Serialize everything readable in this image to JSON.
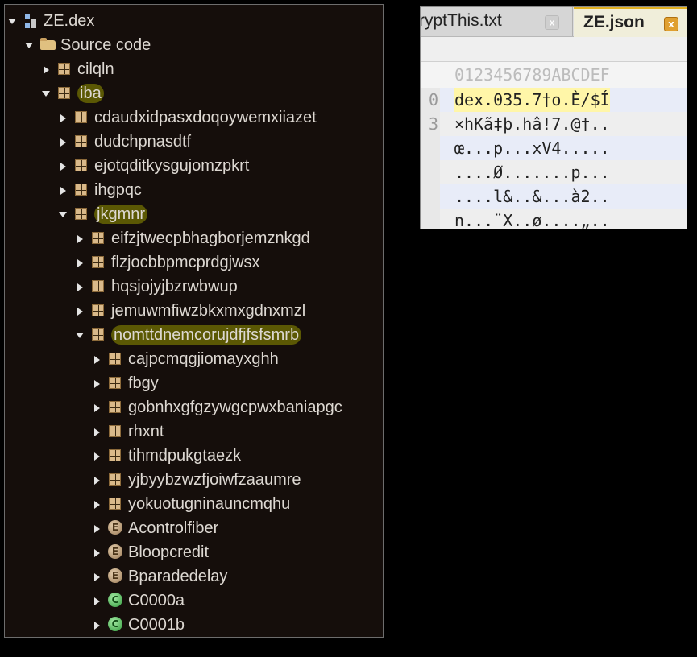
{
  "tree": {
    "rows": [
      {
        "depth": 0,
        "arrow": "expanded",
        "icon": "dex-icon",
        "label": "ZE.dex",
        "hl": false
      },
      {
        "depth": 1,
        "arrow": "expanded",
        "icon": "folder-icon",
        "label": "Source code",
        "hl": false
      },
      {
        "depth": 2,
        "arrow": "collapsed",
        "icon": "package-icon",
        "label": "cilqln",
        "hl": false
      },
      {
        "depth": 2,
        "arrow": "expanded",
        "icon": "package-icon",
        "label": "iba",
        "hl": true
      },
      {
        "depth": 3,
        "arrow": "collapsed",
        "icon": "package-icon",
        "label": "cdaudxidpasxdoqoywemxiiazet",
        "hl": false
      },
      {
        "depth": 3,
        "arrow": "collapsed",
        "icon": "package-icon",
        "label": "dudchpnasdtf",
        "hl": false
      },
      {
        "depth": 3,
        "arrow": "collapsed",
        "icon": "package-icon",
        "label": "ejotqditkysgujomzpkrt",
        "hl": false
      },
      {
        "depth": 3,
        "arrow": "collapsed",
        "icon": "package-icon",
        "label": "ihgpqc",
        "hl": false
      },
      {
        "depth": 3,
        "arrow": "expanded",
        "icon": "package-icon",
        "label": "jkgmnr",
        "hl": true
      },
      {
        "depth": 4,
        "arrow": "collapsed",
        "icon": "package-icon",
        "label": "eifzjtwecpbhagborjemznkgd",
        "hl": false
      },
      {
        "depth": 4,
        "arrow": "collapsed",
        "icon": "package-icon",
        "label": "flzjocbbpmcprdgjwsx",
        "hl": false
      },
      {
        "depth": 4,
        "arrow": "collapsed",
        "icon": "package-icon",
        "label": "hqsjojyjbzrwbwup",
        "hl": false
      },
      {
        "depth": 4,
        "arrow": "collapsed",
        "icon": "package-icon",
        "label": "jemuwmfiwzbkxmxgdnxmzl",
        "hl": false
      },
      {
        "depth": 4,
        "arrow": "expanded",
        "icon": "package-icon",
        "label": "nomttdnemcorujdfjfsfsmrb",
        "hl": true
      },
      {
        "depth": 5,
        "arrow": "collapsed",
        "icon": "package-icon",
        "label": "cajpcmqgjiomayxghh",
        "hl": false
      },
      {
        "depth": 5,
        "arrow": "collapsed",
        "icon": "package-icon",
        "label": "fbgy",
        "hl": false
      },
      {
        "depth": 5,
        "arrow": "collapsed",
        "icon": "package-icon",
        "label": "gobnhxgfgzywgcpwxbaniapgc",
        "hl": false
      },
      {
        "depth": 5,
        "arrow": "collapsed",
        "icon": "package-icon",
        "label": "rhxnt",
        "hl": false
      },
      {
        "depth": 5,
        "arrow": "collapsed",
        "icon": "package-icon",
        "label": "tihmdpukgtaezk",
        "hl": false
      },
      {
        "depth": 5,
        "arrow": "collapsed",
        "icon": "package-icon",
        "label": "yjbyybzwzfjoiwfzaaumre",
        "hl": false
      },
      {
        "depth": 5,
        "arrow": "collapsed",
        "icon": "package-icon",
        "label": "yokuotugninauncmqhu",
        "hl": false
      },
      {
        "depth": 5,
        "arrow": "collapsed",
        "icon": "enum-icon",
        "label": "Acontrolfiber",
        "hl": false
      },
      {
        "depth": 5,
        "arrow": "collapsed",
        "icon": "enum-icon",
        "label": "Bloopcredit",
        "hl": false
      },
      {
        "depth": 5,
        "arrow": "collapsed",
        "icon": "enum-icon",
        "label": "Bparadedelay",
        "hl": false
      },
      {
        "depth": 5,
        "arrow": "collapsed",
        "icon": "class-icon",
        "label": "C0000a",
        "hl": false
      },
      {
        "depth": 5,
        "arrow": "collapsed",
        "icon": "class-icon",
        "label": "C0001b",
        "hl": false
      }
    ]
  },
  "hex": {
    "tabs": [
      {
        "label": "ryptThis.txt",
        "close": "x",
        "active": false
      },
      {
        "label": "ZE.json",
        "close": "x",
        "active": true
      }
    ],
    "header": "0123456789ABCDEF",
    "rows": [
      {
        "offset": "0",
        "text": "dex.035.7†o.È/$Í",
        "selected": true
      },
      {
        "offset": "3",
        "text": "×hKã‡þ.hâ!7.@†..",
        "selected": false
      },
      {
        "offset": "",
        "text": "œ...p...xV4.....",
        "selected": false
      },
      {
        "offset": "",
        "text": "....Ø.......p...",
        "selected": false
      },
      {
        "offset": "",
        "text": "....l&..&...à2..",
        "selected": false
      },
      {
        "offset": "",
        "text": "n...¨X..ø....„..",
        "selected": false
      }
    ]
  },
  "colors": {
    "tree_bg": "#150e0b",
    "tree_text": "#ddd8d2",
    "highlight": "#969600",
    "active_tab_border": "#e0b020"
  }
}
